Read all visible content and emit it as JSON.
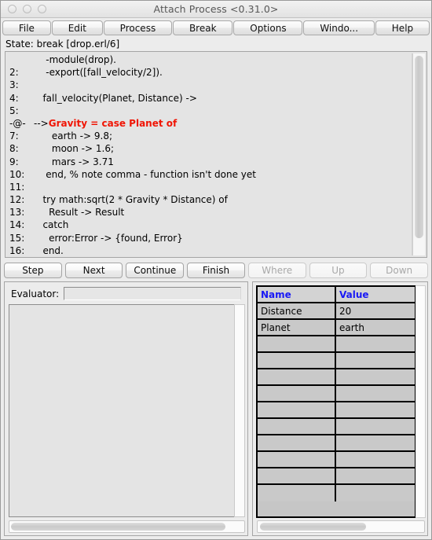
{
  "window": {
    "title": "Attach Process <0.31.0>",
    "traffic_lights": [
      "close-button",
      "minimize-button",
      "zoom-button"
    ]
  },
  "menubar": {
    "items": [
      {
        "label": "File",
        "name": "menu-file"
      },
      {
        "label": "Edit",
        "name": "menu-edit"
      },
      {
        "label": "Process",
        "name": "menu-process"
      },
      {
        "label": "Break",
        "name": "menu-break"
      },
      {
        "label": "Options",
        "name": "menu-options"
      },
      {
        "label": "Windo...",
        "name": "menu-window"
      },
      {
        "label": "Help",
        "name": "menu-help"
      }
    ]
  },
  "status": {
    "state_text": "State: break [drop.erl/6]"
  },
  "code": {
    "lines": [
      {
        "num": "",
        "text": "    -module(drop).",
        "current": false
      },
      {
        "num": "2:",
        "text": "    -export([fall_velocity/2]).",
        "current": false
      },
      {
        "num": "3:",
        "text": "",
        "current": false
      },
      {
        "num": "4:",
        "text": "   fall_velocity(Planet, Distance) ->",
        "current": false
      },
      {
        "num": "5:",
        "text": "",
        "current": false
      },
      {
        "num": "-@-",
        "marker": "-->",
        "text": "Gravity = case Planet of",
        "current": true
      },
      {
        "num": "7:",
        "text": "      earth -> 9.8;",
        "current": false
      },
      {
        "num": "8:",
        "text": "      moon -> 1.6;",
        "current": false
      },
      {
        "num": "9:",
        "text": "      mars -> 3.71",
        "current": false
      },
      {
        "num": "10:",
        "text": "    end, % note comma - function isn't done yet",
        "current": false
      },
      {
        "num": "11:",
        "text": "",
        "current": false
      },
      {
        "num": "12:",
        "text": "   try math:sqrt(2 * Gravity * Distance) of",
        "current": false
      },
      {
        "num": "13:",
        "text": "     Result -> Result",
        "current": false
      },
      {
        "num": "14:",
        "text": "   catch",
        "current": false
      },
      {
        "num": "15:",
        "text": "     error:Error -> {found, Error}",
        "current": false
      },
      {
        "num": "16:",
        "text": "   end.",
        "current": false
      }
    ]
  },
  "controls": {
    "buttons": [
      {
        "label": "Step",
        "name": "step-button",
        "disabled": false
      },
      {
        "label": "Next",
        "name": "next-button",
        "disabled": false
      },
      {
        "label": "Continue",
        "name": "continue-button",
        "disabled": false
      },
      {
        "label": "Finish",
        "name": "finish-button",
        "disabled": false
      },
      {
        "label": "Where",
        "name": "where-button",
        "disabled": true
      },
      {
        "label": "Up",
        "name": "up-button",
        "disabled": true
      },
      {
        "label": "Down",
        "name": "down-button",
        "disabled": true
      }
    ]
  },
  "evaluator": {
    "label": "Evaluator:",
    "value": "",
    "placeholder": "",
    "output": ""
  },
  "bindings": {
    "columns": [
      "Name",
      "Value"
    ],
    "rows": [
      [
        "Distance",
        "20"
      ],
      [
        "Planet",
        "earth"
      ],
      [
        "",
        ""
      ],
      [
        "",
        ""
      ],
      [
        "",
        ""
      ],
      [
        "",
        ""
      ],
      [
        "",
        ""
      ],
      [
        "",
        ""
      ],
      [
        "",
        ""
      ],
      [
        "",
        ""
      ],
      [
        "",
        ""
      ],
      [
        "",
        ""
      ]
    ]
  },
  "colors": {
    "current_line": "#f01505",
    "table_header": "#1919f5",
    "window_bg": "#ececec",
    "code_bg": "#e4e4e4"
  }
}
